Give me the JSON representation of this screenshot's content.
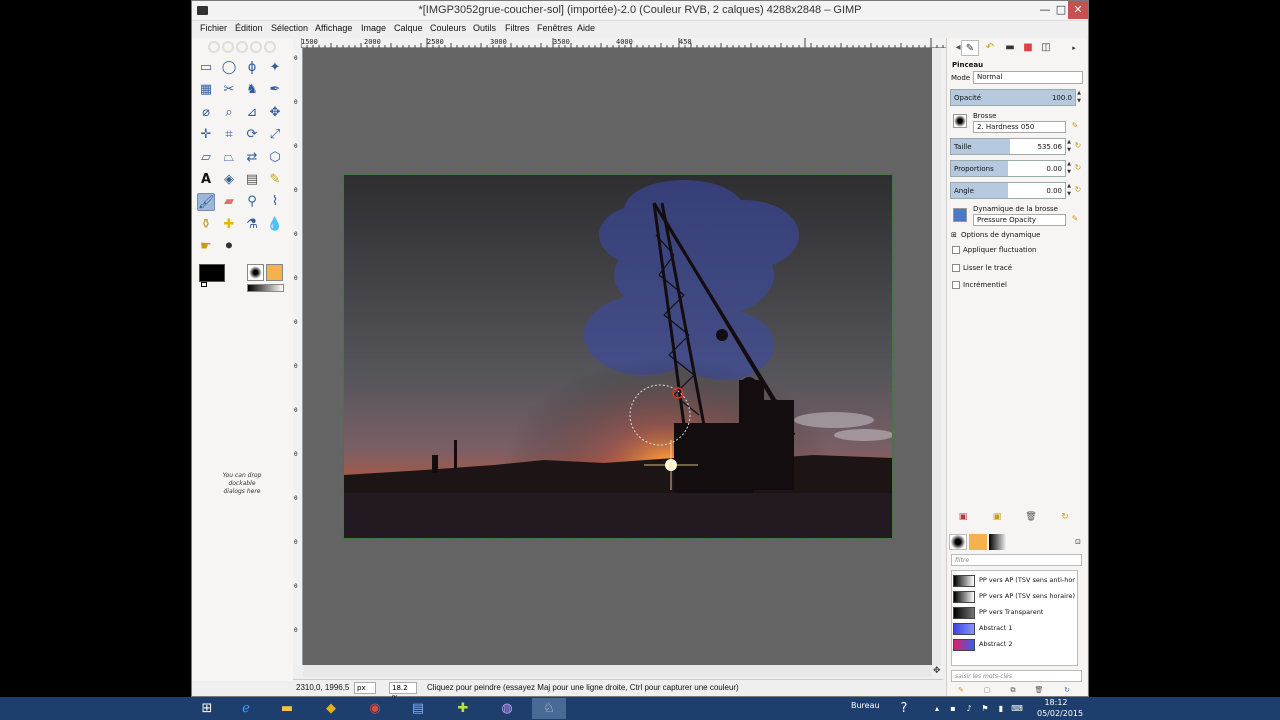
{
  "window": {
    "title": "*[IMGP3052grue-coucher-sol] (importée)-2.0 (Couleur RVB, 2 calques) 4288x2848 – GIMP",
    "min": "—",
    "max": "□",
    "close": "✕"
  },
  "menubar": {
    "items": [
      "Fichier",
      "Édition",
      "Sélection",
      "Affichage",
      "Image",
      "Calque",
      "Couleurs",
      "Outils",
      "Filtres",
      "Fenêtres",
      "Aide"
    ]
  },
  "rulers": {
    "top": [
      "1500",
      "2000",
      "2500",
      "3000",
      "3500",
      "4000",
      "450"
    ],
    "left": [
      "0",
      "0",
      "0",
      "0",
      "0",
      "0",
      "0",
      "0",
      "0",
      "0",
      "0",
      "0",
      "0",
      "0"
    ]
  },
  "toolbox": {
    "drop_hint": "You can drop dockable dialogs here"
  },
  "status": {
    "coords": "2310,0, 1996,5",
    "unit": "px",
    "zoom": "18.2 %",
    "message": "Cliquez pour peindre (essayez Maj pour une ligne droite, Ctrl pour capturer une couleur)"
  },
  "tool_options": {
    "title": "Pinceau",
    "mode_label": "Mode",
    "mode_value": "Normal",
    "opacity_label": "Opacité",
    "opacity_value": "100.0",
    "opacity_fraction": 1.0,
    "brush_label": "Brosse",
    "brush_value": "2. Hardness 050",
    "size_label": "Taille",
    "size_value": "535.06",
    "proportions_label": "Proportions",
    "proportions_value": "0.00",
    "angle_label": "Angle",
    "angle_value": "0.00",
    "dynamics_label": "Dynamique de la brosse",
    "dynamics_value": "Pressure Opacity",
    "dynamics_options": "Options de dynamique",
    "apply_jitter": "Appliquer fluctuation",
    "smooth_stroke": "Lisser le tracé",
    "incremental": "Incrémentiel"
  },
  "gradients": {
    "filter_placeholder": "filtre",
    "tags_placeholder": "saisir les mots-clés",
    "items": [
      {
        "name": "PP vers AP (TSV sens anti-hor",
        "colors": [
          "#000000",
          "#ffffff"
        ]
      },
      {
        "name": "PP vers AP (TSV sens horaire)",
        "colors": [
          "#000000",
          "#ffffff"
        ]
      },
      {
        "name": "PP vers Transparent",
        "colors": [
          "#000000",
          "#777777"
        ]
      },
      {
        "name": "Abstract 1",
        "colors": [
          "#3d44e0",
          "#8a93ff"
        ]
      },
      {
        "name": "Abstract 2",
        "colors": [
          "#e0206a",
          "#3a5ee8"
        ]
      }
    ]
  },
  "taskbar": {
    "tray_label": "Bureau",
    "time": "18:12",
    "date": "05/02/2015"
  },
  "colors": {
    "foreground": "#000000",
    "background": "#ffffff",
    "accent": "#9fb7d6",
    "taskbar": "#1e3f6e"
  }
}
